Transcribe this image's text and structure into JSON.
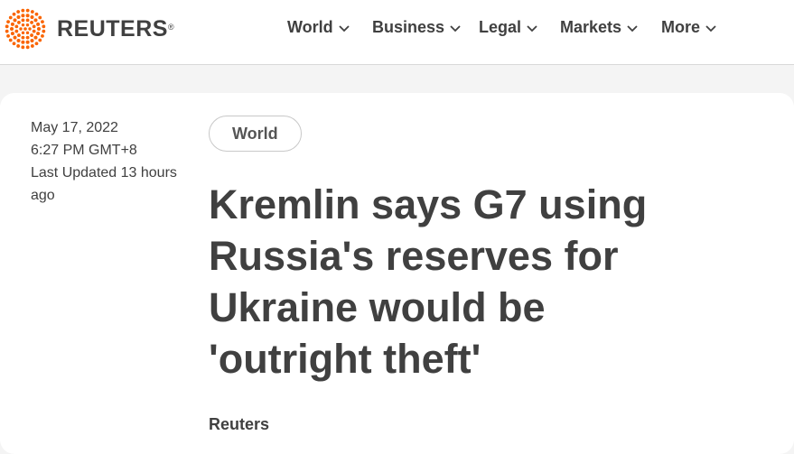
{
  "header": {
    "logo_text": "REUTERS",
    "logo_reg": "®",
    "brand_color": "#fa6400",
    "nav": [
      {
        "label": "World"
      },
      {
        "label": "Business"
      },
      {
        "label": "Legal"
      },
      {
        "label": "Markets"
      },
      {
        "label": "More"
      }
    ]
  },
  "article": {
    "date": "May 17, 2022",
    "time": "6:27 PM GMT+8",
    "updated": "Last Updated 13 hours ago",
    "section": "World",
    "headline": "Kremlin says G7 using Russia's reserves for Ukraine would be 'outright theft'",
    "byline": "Reuters"
  }
}
